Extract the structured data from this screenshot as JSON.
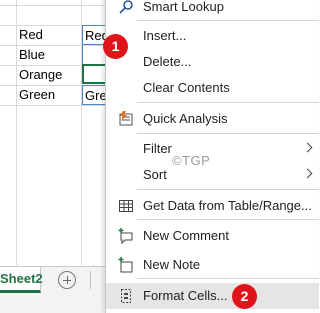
{
  "sheet": {
    "cells": [
      {
        "a": "Red",
        "b": "Red"
      },
      {
        "a": "Blue",
        "b": ""
      },
      {
        "a": "Orange",
        "b": ""
      },
      {
        "a": "Green",
        "b": "Green"
      }
    ],
    "active_tab": "Sheet2"
  },
  "menu": {
    "items": [
      {
        "label": "Smart Lookup",
        "icon": "search-icon"
      },
      {
        "label": "Insert...",
        "icon": ""
      },
      {
        "label": "Delete...",
        "icon": ""
      },
      {
        "label": "Clear Contents",
        "icon": ""
      },
      {
        "label": "Quick Analysis",
        "icon": "quick-analysis-icon"
      },
      {
        "label": "Filter",
        "icon": "",
        "submenu": true
      },
      {
        "label": "Sort",
        "icon": "",
        "submenu": true
      },
      {
        "label": "Get Data from Table/Range...",
        "icon": "table-icon"
      },
      {
        "label": "New Comment",
        "icon": "comment-icon"
      },
      {
        "label": "New Note",
        "icon": "note-icon"
      },
      {
        "label": "Format Cells...",
        "icon": "format-cells-icon",
        "highlighted": true
      }
    ]
  },
  "badges": [
    "1",
    "2"
  ],
  "watermark": "©TGP",
  "colors": {
    "badge": "#e0141b",
    "accent": "#217346",
    "highlight": "#e5e5e5"
  }
}
